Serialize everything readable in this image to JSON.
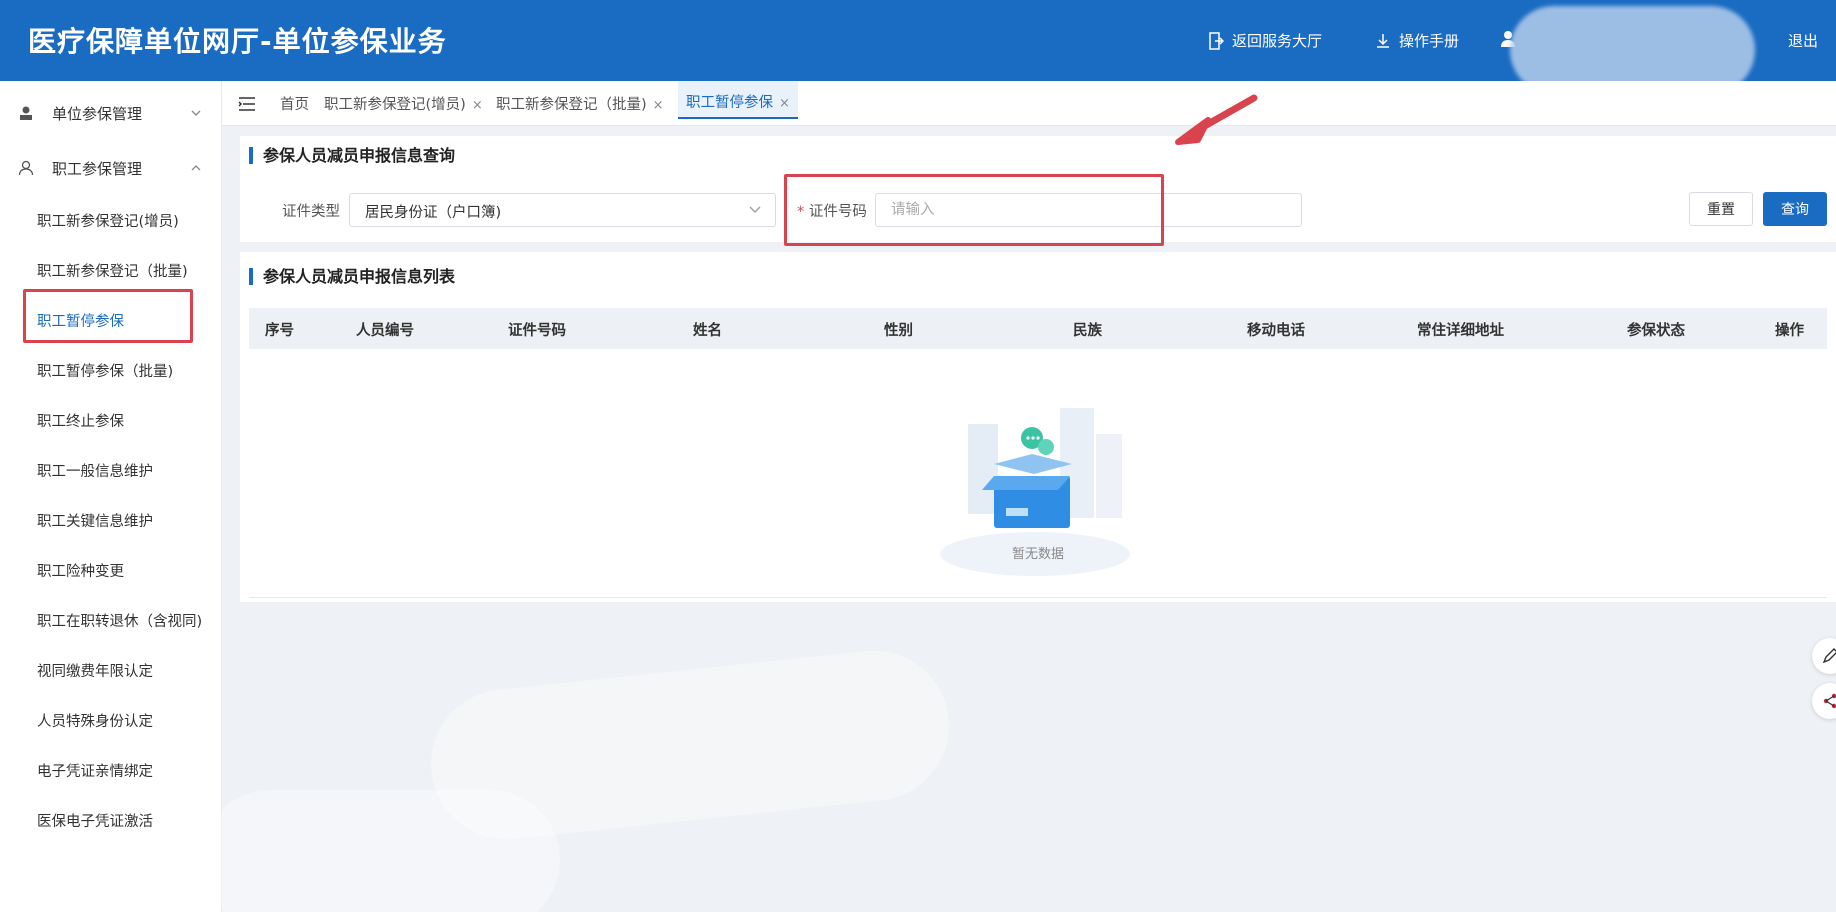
{
  "header": {
    "title": "医疗保障单位网厅-单位参保业务",
    "back_label": "返回服务大厅",
    "manual_label": "操作手册",
    "logout_label": "退出"
  },
  "sidebar": {
    "groups": [
      {
        "label": "单位参保管理"
      },
      {
        "label": "职工参保管理"
      }
    ],
    "items": [
      {
        "label": "职工新参保登记(增员)"
      },
      {
        "label": "职工新参保登记（批量)"
      },
      {
        "label": "职工暂停参保"
      },
      {
        "label": "职工暂停参保（批量)"
      },
      {
        "label": "职工终止参保"
      },
      {
        "label": "职工一般信息维护"
      },
      {
        "label": "职工关键信息维护"
      },
      {
        "label": "职工险种变更"
      },
      {
        "label": "职工在职转退休（含视同)"
      },
      {
        "label": "视同缴费年限认定"
      },
      {
        "label": "人员特殊身份认定"
      },
      {
        "label": "电子凭证亲情绑定"
      },
      {
        "label": "医保电子凭证激活"
      }
    ]
  },
  "tabs": [
    {
      "label": "首页"
    },
    {
      "label": "职工新参保登记(增员)"
    },
    {
      "label": "职工新参保登记（批量)"
    },
    {
      "label": "职工暂停参保"
    }
  ],
  "query": {
    "title": "参保人员减员申报信息查询",
    "cert_type_label": "证件类型",
    "cert_type_value": "居民身份证（户口簿)",
    "cert_no_required": "*",
    "cert_no_label": "证件号码",
    "cert_no_placeholder": "请输入",
    "reset_label": "重置",
    "search_label": "查询"
  },
  "list": {
    "title": "参保人员减员申报信息列表",
    "columns": [
      "序号",
      "人员编号",
      "证件号码",
      "姓名",
      "性别",
      "民族",
      "移动电话",
      "常住详细地址",
      "参保状态",
      "操作"
    ],
    "empty_text": "暂无数据"
  },
  "colors": {
    "brand": "#1a6bc2",
    "highlight": "#d9434e"
  }
}
